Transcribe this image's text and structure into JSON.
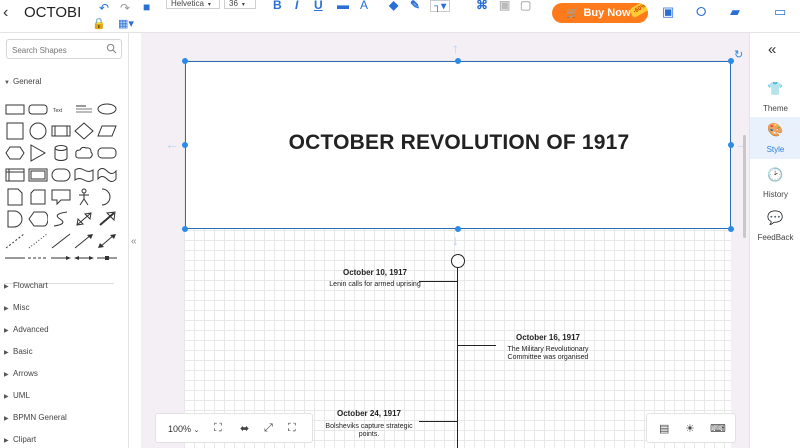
{
  "header": {
    "doc_title": "OCTOBI",
    "font_family_value": "Helvetica",
    "font_size_value": "36",
    "buy_label": "Buy Now",
    "discount_badge": "-60%"
  },
  "left_panel": {
    "search_placeholder": "Search Shapes",
    "general_label": "General",
    "line_thin_label": "Text",
    "categories": [
      "Flowchart",
      "Misc",
      "Advanced",
      "Basic",
      "Arrows",
      "UML",
      "BPMN General",
      "Clipart"
    ]
  },
  "canvas": {
    "title": "OCTOBER REVOLUTION OF 1917",
    "events": [
      {
        "date": "October 10, 1917",
        "desc": "Lenin calls for armed uprising"
      },
      {
        "date": "October 16, 1917",
        "desc": "The Military Revolutionary Committee was organised"
      },
      {
        "date": "October 24, 1917",
        "desc": "Bolsheviks capture strategic points."
      }
    ],
    "zoom_level": "100%"
  },
  "right_panel": {
    "items": [
      {
        "label": "Theme",
        "icon": "shirt-icon"
      },
      {
        "label": "Style",
        "icon": "palette-icon"
      },
      {
        "label": "History",
        "icon": "clock-icon"
      },
      {
        "label": "FeedBack",
        "icon": "feedback-icon"
      }
    ]
  },
  "colors": {
    "accent": "#2b7fd9",
    "buy": "#ff7a1a",
    "selection": "#2b8be6"
  }
}
